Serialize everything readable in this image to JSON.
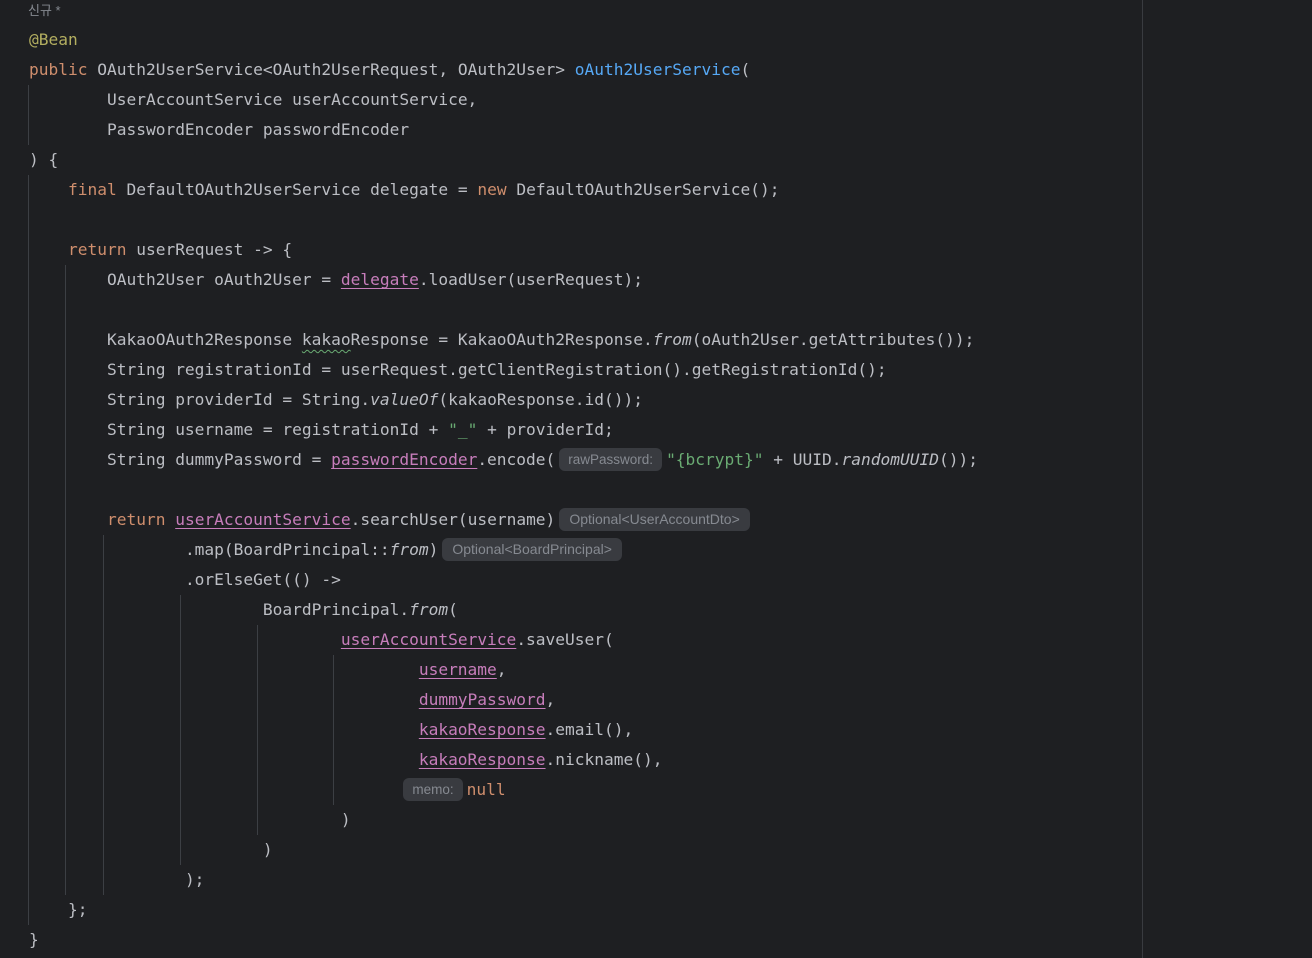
{
  "editor": {
    "usage_hint": "신규 *",
    "hints": {
      "raw_password": "rawPassword:",
      "optional_dto": "Optional<UserAccountDto>",
      "optional_principal": "Optional<BoardPrincipal>",
      "memo": "memo:"
    },
    "tok": {
      "bean": "@Bean",
      "public": "public",
      "return_type": "OAuth2UserService<OAuth2UserRequest, OAuth2User>",
      "method_name": "oAuth2UserService",
      "open_paren": "(",
      "param1": "UserAccountService userAccountService,",
      "param2": "PasswordEncoder passwordEncoder",
      "close_sig": ") {",
      "final": "final",
      "delegate_decl": "DefaultOAuth2UserService delegate = ",
      "new": "new",
      "delegate_init": "DefaultOAuth2UserService();",
      "return": "return",
      "lambda_head": "userRequest -> {",
      "user_decl": "OAuth2User oAuth2User = ",
      "delegate": "delegate",
      "load_user": ".loadUser(userRequest);",
      "kakao_type": "KakaoOAuth2Response ",
      "kakao_warn": "kakao",
      "kakao_rest": "Response = KakaoOAuth2Response.",
      "from": "from",
      "kakao_args": "(oAuth2User.getAttributes());",
      "registration": "String registrationId = userRequest.getClientRegistration().getRegistrationId();",
      "provider_pre": "String providerId = String.",
      "value_of": "valueOf",
      "provider_args": "(kakaoResponse.id());",
      "username_pre": "String username = registrationId + ",
      "underscore_str": "\"_\"",
      "username_post": " + providerId;",
      "dummy_pre": "String dummyPassword = ",
      "password_encoder": "passwordEncoder",
      "encode": ".encode(",
      "bcrypt_str": "\"{bcrypt}\"",
      "uuid_pre": " + UUID.",
      "random_uuid": "randomUUID",
      "uuid_post": "());",
      "user_account_service": "userAccountService",
      "search_user": ".searchUser(username)",
      "map_pre": ".map(BoardPrincipal::",
      "map_post": ")",
      "or_else_get": ".orElseGet(() ->",
      "principal_pre": "BoardPrincipal.",
      "principal_post": "(",
      "save_user": ".saveUser(",
      "username": "username",
      "comma": ",",
      "dummy_password": "dummyPassword",
      "kakao_response": "kakaoResponse",
      "email": ".email(),",
      "nickname": ".nickname(),",
      "null": "null",
      "close_paren": ")",
      "close_stmt": ");",
      "close_lambda": "};",
      "close_brace": "}"
    }
  }
}
